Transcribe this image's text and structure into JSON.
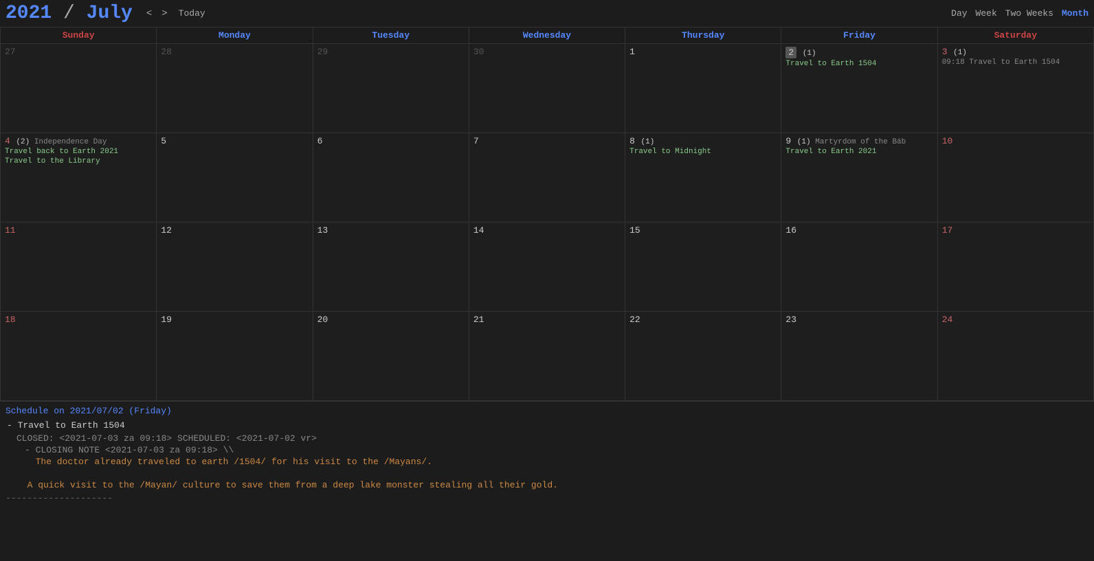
{
  "header": {
    "year": "2021",
    "slash": " / ",
    "month": "July",
    "nav_prev": "<",
    "nav_next": ">",
    "today_label": "Today",
    "views": [
      "Day",
      "Week",
      "Two Weeks",
      "Month"
    ],
    "active_view": "Month"
  },
  "weekdays": [
    "Sunday",
    "Monday",
    "Tuesday",
    "Wednesday",
    "Thursday",
    "Friday",
    "Saturday"
  ],
  "weeks": [
    {
      "days": [
        {
          "num": "27",
          "type": "prev",
          "events": []
        },
        {
          "num": "28",
          "type": "prev",
          "events": []
        },
        {
          "num": "29",
          "type": "prev",
          "events": []
        },
        {
          "num": "30",
          "type": "prev",
          "events": []
        },
        {
          "num": "1",
          "type": "current",
          "events": []
        },
        {
          "num": "2",
          "type": "current",
          "badge": "(1)",
          "today": true,
          "events": [
            {
              "text": "Travel to Earth 1504",
              "color": "green"
            }
          ]
        },
        {
          "num": "3",
          "type": "current",
          "badge": "(1)",
          "events": [
            {
              "text": "09:18 Travel to Earth 1504",
              "color": "timed"
            }
          ]
        }
      ]
    },
    {
      "days": [
        {
          "num": "4",
          "type": "current",
          "badge": "(2)",
          "holiday": "Independence Day",
          "events": [
            {
              "text": "Travel back to Earth 2021",
              "color": "green"
            },
            {
              "text": "Travel to the Library",
              "color": "green"
            }
          ]
        },
        {
          "num": "5",
          "type": "current",
          "events": []
        },
        {
          "num": "6",
          "type": "current",
          "events": []
        },
        {
          "num": "7",
          "type": "current",
          "events": []
        },
        {
          "num": "8",
          "type": "current",
          "badge": "(1)",
          "events": [
            {
              "text": "Travel to Midnight",
              "color": "green"
            }
          ]
        },
        {
          "num": "9",
          "type": "current",
          "badge": "(1)",
          "holiday": "Martyrdom of the Báb",
          "events": [
            {
              "text": "Travel to Earth 2021",
              "color": "green"
            }
          ]
        },
        {
          "num": "10",
          "type": "current",
          "events": []
        }
      ]
    },
    {
      "days": [
        {
          "num": "11",
          "type": "current",
          "events": []
        },
        {
          "num": "12",
          "type": "current",
          "events": []
        },
        {
          "num": "13",
          "type": "current",
          "events": []
        },
        {
          "num": "14",
          "type": "current",
          "events": []
        },
        {
          "num": "15",
          "type": "current",
          "events": []
        },
        {
          "num": "16",
          "type": "current",
          "events": []
        },
        {
          "num": "17",
          "type": "current",
          "events": []
        }
      ]
    },
    {
      "days": [
        {
          "num": "18",
          "type": "current",
          "events": []
        },
        {
          "num": "19",
          "type": "current",
          "events": []
        },
        {
          "num": "20",
          "type": "current",
          "events": []
        },
        {
          "num": "21",
          "type": "current",
          "events": []
        },
        {
          "num": "22",
          "type": "current",
          "events": []
        },
        {
          "num": "23",
          "type": "current",
          "events": []
        },
        {
          "num": "24",
          "type": "current",
          "events": []
        }
      ]
    }
  ],
  "schedule": {
    "title": "Schedule on 2021/07/02 (Friday)",
    "events": [
      {
        "title": "- Travel to Earth 1504",
        "closed_line": "CLOSED: <2021-07-03 za 09:18> SCHEDULED: <2021-07-02 vr>",
        "closing_note_label": "- CLOSING NOTE <2021-07-03 za 09:18> \\\\",
        "closing_note_text": "  The doctor already traveled to earth /1504/ for his visit to the /Mayans/.",
        "description": "  A quick visit to the /Mayan/ culture to save them from a deep lake monster stealing all their gold."
      }
    ],
    "divider": "--------------------"
  }
}
